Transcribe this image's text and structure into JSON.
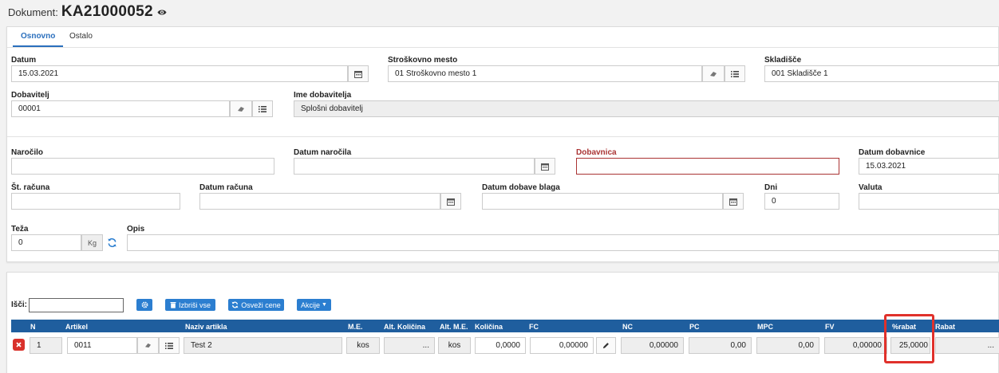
{
  "header": {
    "doc_label": "Dokument:",
    "doc_number": "KA21000052",
    "view_icon": "eye-icon"
  },
  "tabs": [
    {
      "label": "Osnovno",
      "active": true
    },
    {
      "label": "Ostalo",
      "active": false
    }
  ],
  "form": {
    "datum": {
      "label": "Datum",
      "value": "15.03.2021"
    },
    "strm": {
      "label": "Stroškovno mesto",
      "value": "01 Stroškovno mesto 1"
    },
    "sklad": {
      "label": "Skladišče",
      "value": "001 Skladišče 1"
    },
    "dobav": {
      "label": "Dobavitelj",
      "value": "00001"
    },
    "imedob": {
      "label": "Ime dobavitelja",
      "value": "Splošni dobavitelj"
    },
    "narocilo": {
      "label": "Naročilo",
      "value": ""
    },
    "datnar": {
      "label": "Datum naročila",
      "value": ""
    },
    "dobavnica": {
      "label": "Dobavnica",
      "value": ""
    },
    "datdobavnice": {
      "label": "Datum dobavnice",
      "value": "15.03.2021"
    },
    "stracuna": {
      "label": "Št. računa",
      "value": ""
    },
    "datracuna": {
      "label": "Datum računa",
      "value": ""
    },
    "datdobave": {
      "label": "Datum dobave blaga",
      "value": ""
    },
    "dni": {
      "label": "Dni",
      "value": "0"
    },
    "valuta": {
      "label": "Valuta",
      "value": ""
    },
    "teza": {
      "label": "Teža",
      "value": "0",
      "unit": "Kg"
    },
    "opis": {
      "label": "Opis",
      "value": ""
    }
  },
  "toolbar": {
    "search_label": "Išči:",
    "search_value": "",
    "delete_all": "Izbriši vse",
    "refresh_prices": "Osveži cene",
    "actions": "Akcije"
  },
  "table": {
    "headers": [
      "N",
      "Artikel",
      "Naziv artikla",
      "M.E.",
      "Alt. Količina",
      "Alt. M.E.",
      "Količina",
      "FC",
      "NC",
      "PC",
      "MPC",
      "FV",
      "%rabat",
      "Rabat"
    ],
    "row": {
      "n": "1",
      "artikel": "0011",
      "naziv": "Test 2",
      "me": "kos",
      "alt_kol": "...",
      "alt_me": "kos",
      "kolicina": "0,0000",
      "fc": "0,00000",
      "nc": "0,00000",
      "pc": "0,00",
      "mpc": "0,00",
      "fv": "0,00000",
      "rabat_pct": "25,0000",
      "rabat": "..."
    }
  },
  "colors": {
    "accent": "#2b7ed0",
    "table_header": "#1f5e9e",
    "error": "#a33333",
    "highlight": "#e0312b"
  }
}
